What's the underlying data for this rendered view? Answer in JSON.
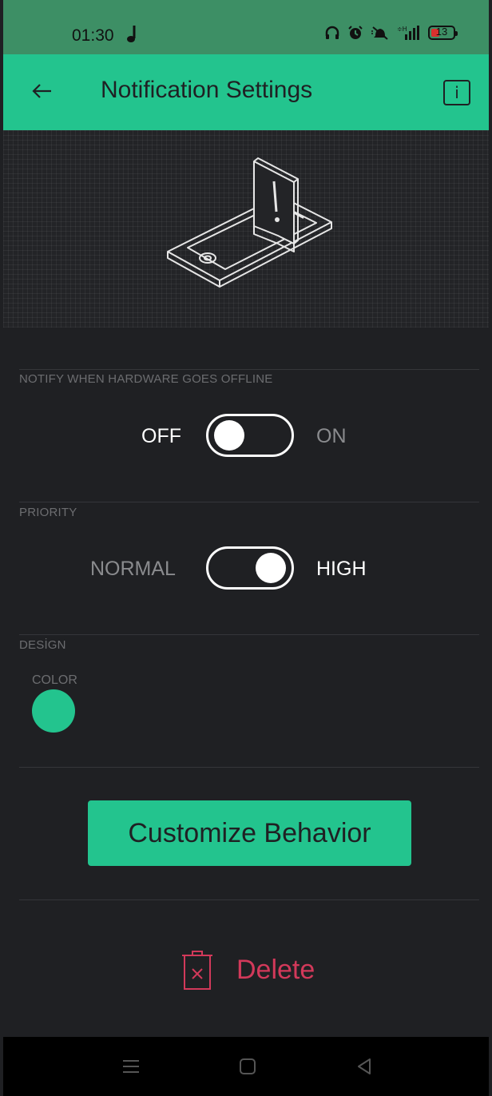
{
  "status_bar": {
    "time": "01:30",
    "battery": "13",
    "icons": [
      "music-note-icon",
      "headphones-icon",
      "alarm-icon",
      "mute-icon",
      "signal-icon",
      "battery-icon"
    ]
  },
  "app_bar": {
    "title": "Notification Settings",
    "back_icon": "arrow-left-icon",
    "info_label": "i"
  },
  "offline": {
    "section_label": "NOTIFY WHEN HARDWARE GOES OFFLINE",
    "off_label": "OFF",
    "on_label": "ON",
    "state": "off"
  },
  "priority": {
    "section_label": "PRIORITY",
    "normal_label": "NORMAL",
    "high_label": "HIGH",
    "state": "high"
  },
  "design": {
    "section_label": "DESİGN",
    "color_label": "COLOR",
    "color": "#23c48e"
  },
  "customize_button": "Customize Behavior",
  "delete_button": "Delete",
  "colors": {
    "accent": "#23c48e",
    "background": "#1f2023",
    "danger": "#d2395a",
    "status_bar": "#3d8f65"
  },
  "nav_bar": {
    "icons": [
      "menu-icon",
      "home-icon",
      "back-icon"
    ]
  }
}
